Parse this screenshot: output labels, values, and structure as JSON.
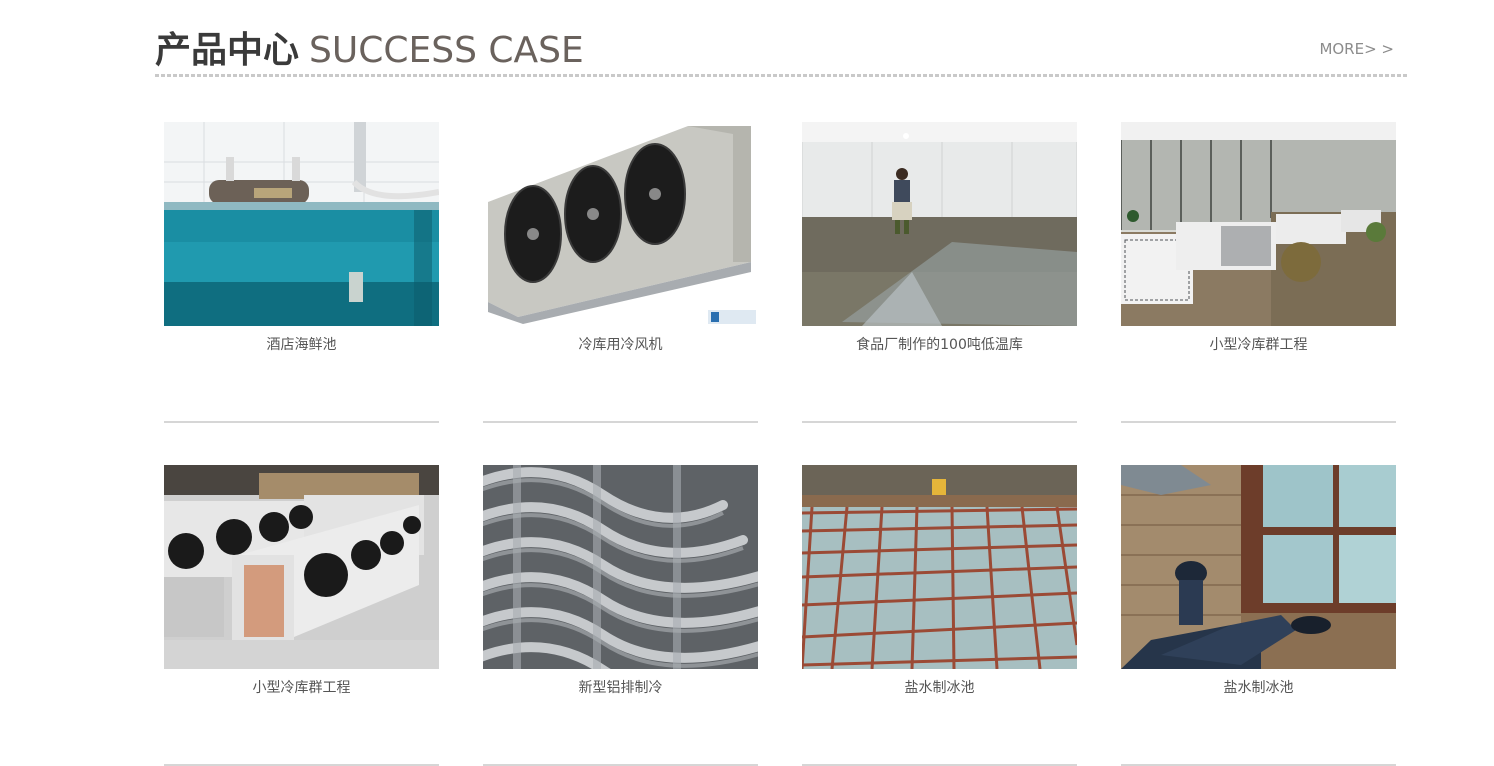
{
  "section": {
    "title_cn": "产品中心",
    "title_en": "SUCCESS CASE",
    "more_label": "MORE> >"
  },
  "products": [
    {
      "caption": "酒店海鲜池",
      "image": "seafood-tank-image"
    },
    {
      "caption": "冷库用冷风机",
      "image": "air-cooler-unit-image"
    },
    {
      "caption": "食品厂制作的100吨低温库",
      "image": "cold-room-construction-image"
    },
    {
      "caption": "小型冷库群工程",
      "image": "outdoor-condensing-units-image"
    },
    {
      "caption": "小型冷库群工程",
      "image": "evaporator-fans-image"
    },
    {
      "caption": "新型铝排制冷",
      "image": "aluminum-coil-pipes-image"
    },
    {
      "caption": "盐水制冰池",
      "image": "brine-ice-pool-grid-image"
    },
    {
      "caption": "盐水制冰池",
      "image": "brine-ice-pool-closeup-image"
    }
  ],
  "colors": {
    "title_cn": "#3a3a3a",
    "title_en": "#6a625d",
    "more": "#8c8c8c",
    "caption": "#555555",
    "rule": "#d6d6d6"
  }
}
